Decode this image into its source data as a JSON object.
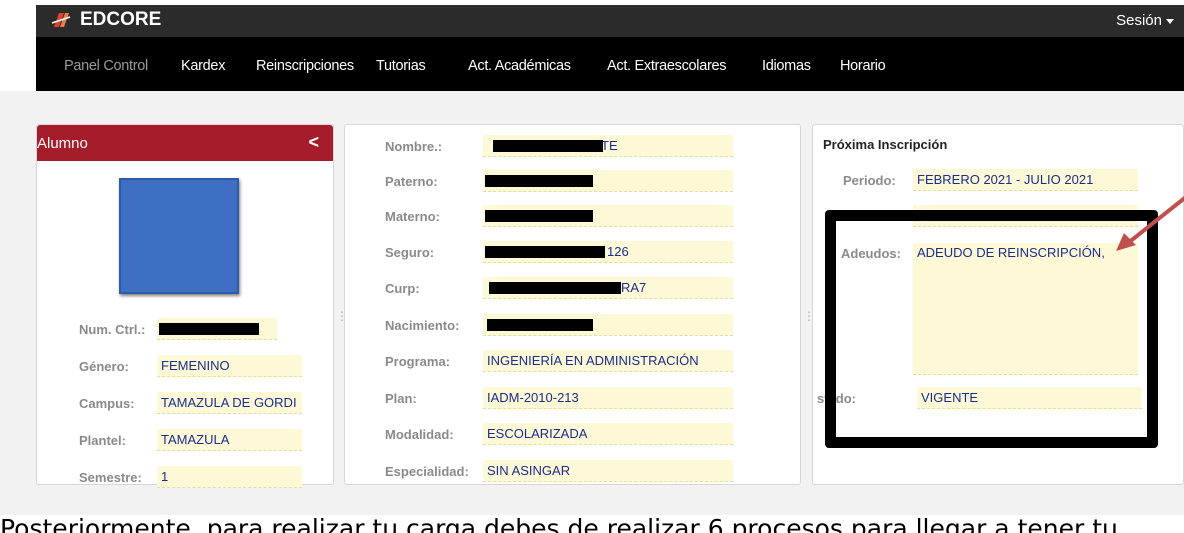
{
  "app": {
    "brand": "EDCORE",
    "session_label": "Sesión"
  },
  "nav": [
    "Panel Control",
    "Kardex",
    "Reinscripciones",
    "Tutorias",
    "Act. Académicas",
    "Act. Extraescolares",
    "Idiomas",
    "Horario"
  ],
  "alumno": {
    "title": "Alumno",
    "collapse_glyph": "<",
    "fields": [
      {
        "label": "Num. Ctrl.:",
        "value": "",
        "redacted": true
      },
      {
        "label": "Género:",
        "value": "FEMENINO"
      },
      {
        "label": "Campus:",
        "value": "TAMAZULA DE GORDI"
      },
      {
        "label": "Plantel:",
        "value": "TAMAZULA"
      },
      {
        "label": "Semestre:",
        "value": "1"
      }
    ]
  },
  "datos": {
    "fields": [
      {
        "label": "Nombre.:",
        "value": "TE"
      },
      {
        "label": "Paterno:",
        "value": ""
      },
      {
        "label": "Materno:",
        "value": ""
      },
      {
        "label": "Seguro:",
        "value": "126"
      },
      {
        "label": "Curp:",
        "value": "RA7"
      },
      {
        "label": "Nacimiento:",
        "value": ""
      },
      {
        "label": "Programa:",
        "value": "INGENIERÍA EN ADMINISTRACIÓN"
      },
      {
        "label": "Plan:",
        "value": "IADM-2010-213"
      },
      {
        "label": "Modalidad:",
        "value": "ESCOLARIZADA"
      },
      {
        "label": "Especialidad:",
        "value": "SIN ASINGAR"
      }
    ]
  },
  "inscripcion": {
    "title": "Próxima Inscripción",
    "periodo_label": "Periodo:",
    "periodo_value": "FEBRERO 2021 - JULIO 2021",
    "adeudos_label": "Adeudos:",
    "adeudos_value": "ADEUDO DE REINSCRIPCIÓN,",
    "estado_label": "stado:",
    "estado_value": "VIGENTE"
  },
  "caption": "Posteriormente, para realizar tu carga debes de realizar 6 procesos para llegar a tener tu",
  "colors": {
    "accent": "#a51c2b",
    "field_bg": "#fdf9d7",
    "value_text": "#1a2d8e"
  }
}
